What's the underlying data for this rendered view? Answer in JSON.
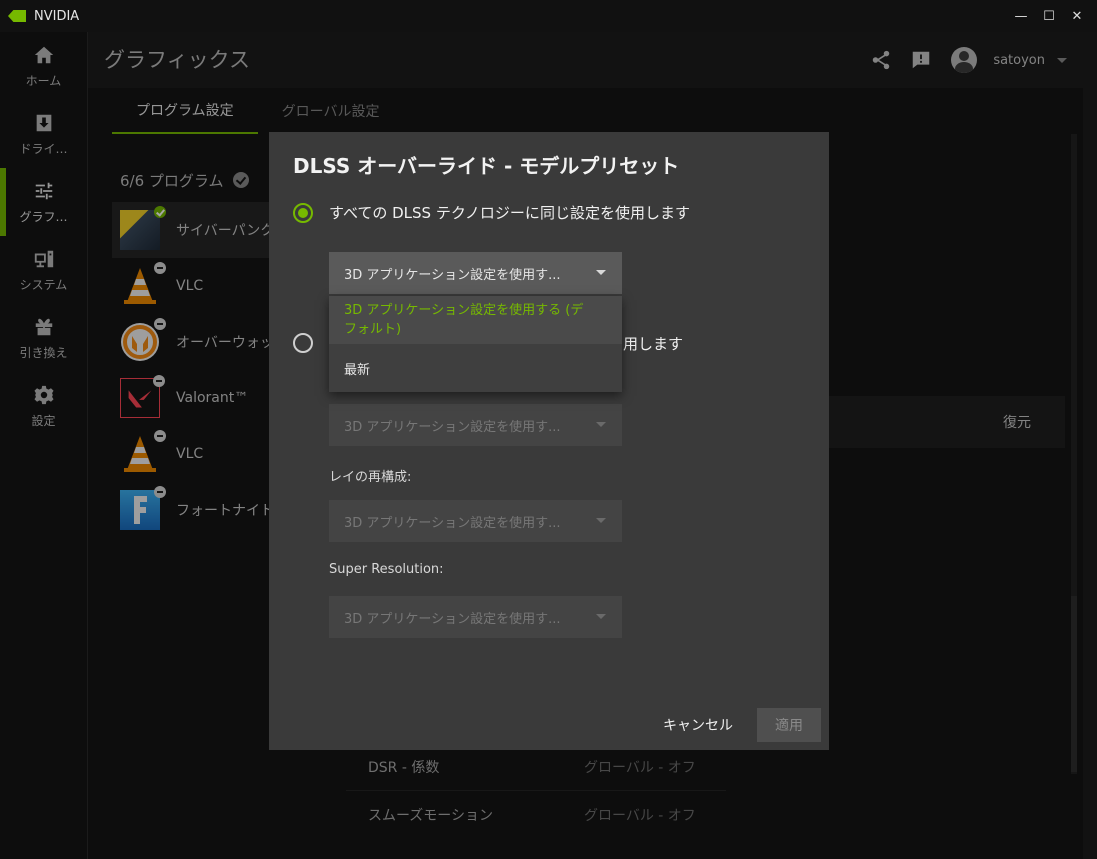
{
  "window": {
    "title": "NVIDIA",
    "minimize": "—",
    "maximize": "☐",
    "close": "✕"
  },
  "nav": {
    "items": [
      {
        "label": "ホーム",
        "icon": "home-icon"
      },
      {
        "label": "ドライ…",
        "icon": "download-icon"
      },
      {
        "label": "グラフ…",
        "icon": "sliders-icon"
      },
      {
        "label": "システム",
        "icon": "system-icon"
      },
      {
        "label": "引き換え",
        "icon": "gift-icon"
      },
      {
        "label": "設定",
        "icon": "gear-icon"
      }
    ]
  },
  "header": {
    "title": "グラフィックス",
    "username": "satoyon"
  },
  "tabs": [
    {
      "label": "プログラム設定"
    },
    {
      "label": "グローバル設定"
    }
  ],
  "programs": {
    "count": "6/6 プログラム",
    "items": [
      {
        "name": "サイバーパンク"
      },
      {
        "name": "VLC"
      },
      {
        "name": "オーバーウォッ"
      },
      {
        "name": "Valorant™"
      },
      {
        "name": "VLC"
      },
      {
        "name": "フォートナイト"
      }
    ]
  },
  "background": {
    "restore_label": "復元",
    "rows": [
      {
        "key": "DSR - 係数",
        "value": "グローバル - オフ"
      },
      {
        "key": "スムーズモーション",
        "value": "グローバル - オフ"
      }
    ]
  },
  "dialog": {
    "title": "DLSS オーバーライド - モデルプリセット",
    "radio1_label": "すべての DLSS テクノロジーに同じ設定を使用します",
    "radio2_tail": "用します",
    "select1_value": "3D アプリケーション設定を使用す...",
    "menu": {
      "option1_line1": "3D アプリケーション設定を使用する (デ",
      "option1_line2": "フォルト)",
      "option2": "最新"
    },
    "select2_value": "3D アプリケーション設定を使用す...",
    "label_ray": "レイの再構成:",
    "select3_value": "3D アプリケーション設定を使用す...",
    "label_sr": "Super Resolution:",
    "select4_value": "3D アプリケーション設定を使用す...",
    "cancel": "キャンセル",
    "apply": "適用"
  },
  "colors": {
    "accent": "#76b900"
  }
}
